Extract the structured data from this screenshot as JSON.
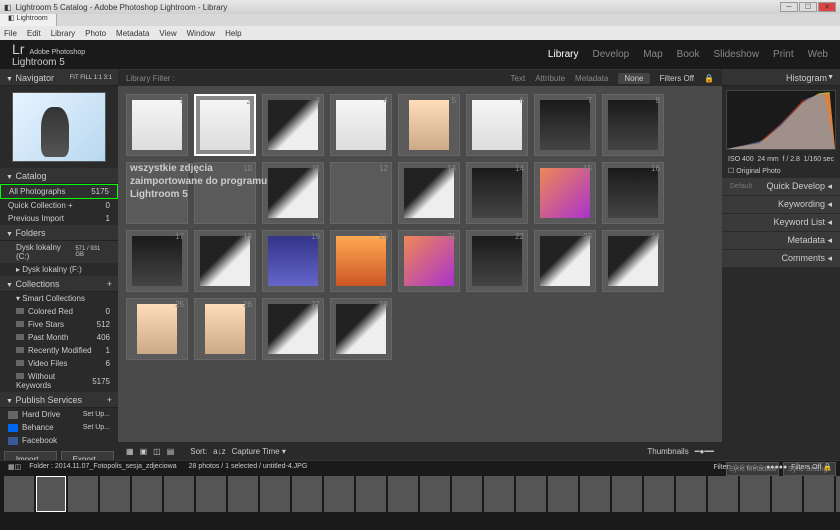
{
  "window": {
    "title": "Lightroom 5 Catalog - Adobe Photoshop Lightroom - Library"
  },
  "menu": [
    "File",
    "Edit",
    "Library",
    "Photo",
    "Metadata",
    "View",
    "Window",
    "Help"
  ],
  "app": {
    "name_prefix": "Adobe Photoshop",
    "name": "Lightroom 5",
    "lr": "Lr"
  },
  "modules": [
    "Library",
    "Develop",
    "Map",
    "Book",
    "Slideshow",
    "Print",
    "Web"
  ],
  "active_module": "Library",
  "left": {
    "navigator": {
      "label": "Navigator",
      "zoom": "FIT   FILL   1:1   3:1"
    },
    "catalog": {
      "label": "Catalog",
      "items": [
        {
          "name": "All Photographs",
          "count": "5175",
          "hl": true
        },
        {
          "name": "Quick Collection +",
          "count": "0"
        },
        {
          "name": "Previous Import",
          "count": "1"
        }
      ]
    },
    "folders": {
      "label": "Folders",
      "volume": {
        "name": "Dysk lokalny (C:)",
        "info": "571 / 931 GB"
      },
      "items": [
        {
          "name": "Dysk lokalny (F:)",
          "count": ""
        }
      ]
    },
    "collections": {
      "label": "Collections",
      "items": [
        {
          "name": "Smart Collections",
          "count": ""
        },
        {
          "name": "Colored Red",
          "count": "0"
        },
        {
          "name": "Five Stars",
          "count": "512"
        },
        {
          "name": "Past Month",
          "count": "406"
        },
        {
          "name": "Recently Modified",
          "count": "1"
        },
        {
          "name": "Video Files",
          "count": "6"
        },
        {
          "name": "Without Keywords",
          "count": "5175"
        }
      ]
    },
    "publish": {
      "label": "Publish Services",
      "items": [
        {
          "name": "Hard Drive",
          "cls": "hd",
          "extra": "Set Up..."
        },
        {
          "name": "Behance",
          "cls": "be",
          "extra": "Set Up..."
        },
        {
          "name": "Facebook",
          "cls": "fb",
          "extra": ""
        }
      ]
    },
    "buttons": {
      "import": "Import...",
      "export": "Export..."
    }
  },
  "filter": {
    "label": "Library Filter :",
    "opts": [
      "Text",
      "Attribute",
      "Metadata",
      "None"
    ],
    "active": "None",
    "right": "Filters Off"
  },
  "annotation": {
    "l1": "wszystkie zdjęcia",
    "l2": "zaimportowane do programu",
    "l3": "Lightroom 5"
  },
  "grid_rows": [
    [
      {
        "n": "1",
        "c": "th-light"
      },
      {
        "n": "2",
        "c": "th-light",
        "sel": true
      },
      {
        "n": "3",
        "c": "th-bw"
      },
      {
        "n": "4",
        "c": "th-light"
      },
      {
        "n": "5",
        "c": "th-port"
      },
      {
        "n": "6",
        "c": "th-light"
      },
      {
        "n": "7",
        "c": "th-dark"
      },
      {
        "n": "8",
        "c": "th-dark"
      }
    ],
    [
      {
        "n": "9",
        "c": ""
      },
      {
        "n": "10",
        "c": ""
      },
      {
        "n": "11",
        "c": "th-bw"
      },
      {
        "n": "12",
        "c": ""
      },
      {
        "n": "13",
        "c": "th-bw"
      },
      {
        "n": "14",
        "c": "th-dark"
      },
      {
        "n": "15",
        "c": "th-color"
      },
      {
        "n": "16",
        "c": "th-dark"
      }
    ],
    [
      {
        "n": "17",
        "c": "th-dark"
      },
      {
        "n": "18",
        "c": "th-bw"
      },
      {
        "n": "19",
        "c": "th-blue"
      },
      {
        "n": "20",
        "c": "th-warm"
      },
      {
        "n": "21",
        "c": "th-color"
      },
      {
        "n": "22",
        "c": "th-dark"
      },
      {
        "n": "23",
        "c": "th-bw"
      },
      {
        "n": "24",
        "c": "th-bw"
      }
    ],
    [
      {
        "n": "25",
        "c": "th-port"
      },
      {
        "n": "26",
        "c": "th-port"
      },
      {
        "n": "27",
        "c": "th-bw"
      },
      {
        "n": "28",
        "c": "th-bw"
      }
    ]
  ],
  "toolbar": {
    "sort": "Sort:",
    "sortval": "Capture Time",
    "thumbs": "Thumbnails"
  },
  "right": {
    "histogram": {
      "label": "Histogram",
      "iso": "ISO 400",
      "focal": "24 mm",
      "ap": "f / 2.8",
      "sh": "1/160 sec",
      "orig": "Original Photo"
    },
    "sections": [
      {
        "name": "Quick Develop",
        "pre": "Default"
      },
      {
        "name": "Keywording"
      },
      {
        "name": "Keyword List"
      },
      {
        "name": "Metadata"
      },
      {
        "name": "Comments"
      }
    ],
    "sync": {
      "meta": "Sync Metadata",
      "settings": "Sync Settings"
    }
  },
  "status": {
    "path": "Folder : 2014.11.07_Fotopolis_sesja_zdjeciowa",
    "info": "28 photos / 1 selected / untitled-4.JPG",
    "filter": "Filter:",
    "filters_off": "Filters Off"
  }
}
